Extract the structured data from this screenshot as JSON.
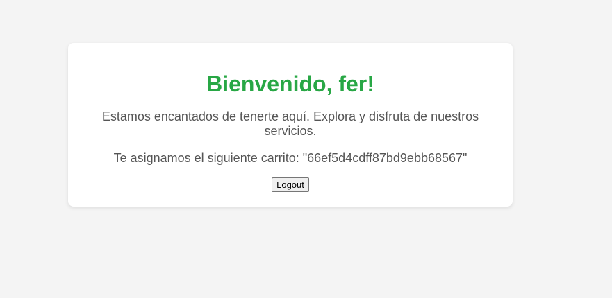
{
  "welcome": {
    "title": "Bienvenido, fer!",
    "intro": "Estamos encantados de tenerte aquí. Explora y disfruta de nuestros servicios.",
    "cart_prefix": "Te asignamos el siguiente carrito: ",
    "cart_id": "\"66ef5d4cdff87bd9ebb68567\"",
    "logout_label": "Logout"
  },
  "colors": {
    "accent": "#28a745",
    "text": "#555555",
    "background": "#f4f4f4",
    "card": "#ffffff"
  }
}
